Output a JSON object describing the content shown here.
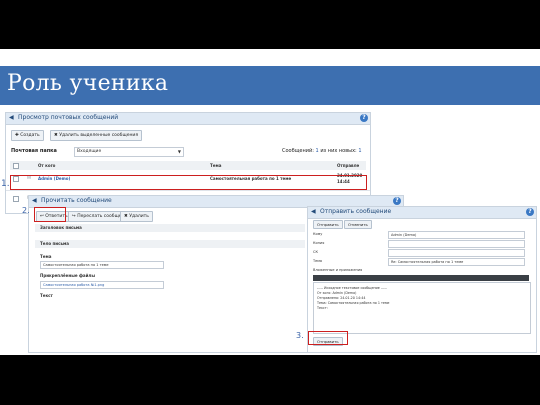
{
  "slide": {
    "title": "Роль ученика"
  },
  "mailbox": {
    "header": "Просмотр почтовых сообщений",
    "create_btn": "Создать",
    "delete_btn": "Удалить выделенные сообщения",
    "folder_label": "Почтовая папка",
    "folder_value": "Входящие",
    "messages_label": "Сообщений:",
    "messages_count": "1",
    "new_label": "из них новых:",
    "new_count": "1",
    "col_from": "От кого",
    "col_subject": "Тема",
    "col_sent": "Отправле",
    "row": {
      "from": "Admin (Demo)",
      "subject": "Самостоятельная работа по 1 теме",
      "date": "24.01.2020",
      "time": "14:44"
    }
  },
  "viewer": {
    "header": "Прочитать сообщение",
    "reply_btn": "Ответить",
    "forward_btn": "Переслать сообщение",
    "delete_btn": "Удалить",
    "section_header": "Заголовок письма",
    "body_header": "Тело письма",
    "subject_label": "Тема",
    "subject_value": "Самостоятельная работа по 1 теме",
    "files_label": "Прикреплённые файлы",
    "file_name": "Самостоятельная работа №1.png",
    "text_label": "Текст"
  },
  "reply": {
    "header": "Отправить сообщение",
    "send_btn": "Отправить",
    "cancel_btn": "Отменить",
    "to_label": "Кому",
    "to_value": "Admin (Demo)",
    "copy_label": "Копия",
    "hidden_label": "СК",
    "subject_label": "Тема",
    "subject_value": "Re: Самостоятельная работа по 1 теме",
    "attach_label": "Вложенные и приложения",
    "quote_line1": "----- Исходное текстовое сообщение -----",
    "quote_line2": "От кого: Admin (Demo)",
    "quote_line3": "Отправлено: 24.01.20   14:44",
    "quote_line4": "Тема: Самостоятельная работа по 1 теме",
    "quote_line5": "Текст:",
    "bottom_btn": "Отправить"
  },
  "steps": {
    "s1": "1.",
    "s2": "2.",
    "s3": "3."
  },
  "colors": {
    "accent": "#3d6fb0",
    "highlight": "#cc1f1f",
    "step": "#3a63a8"
  }
}
